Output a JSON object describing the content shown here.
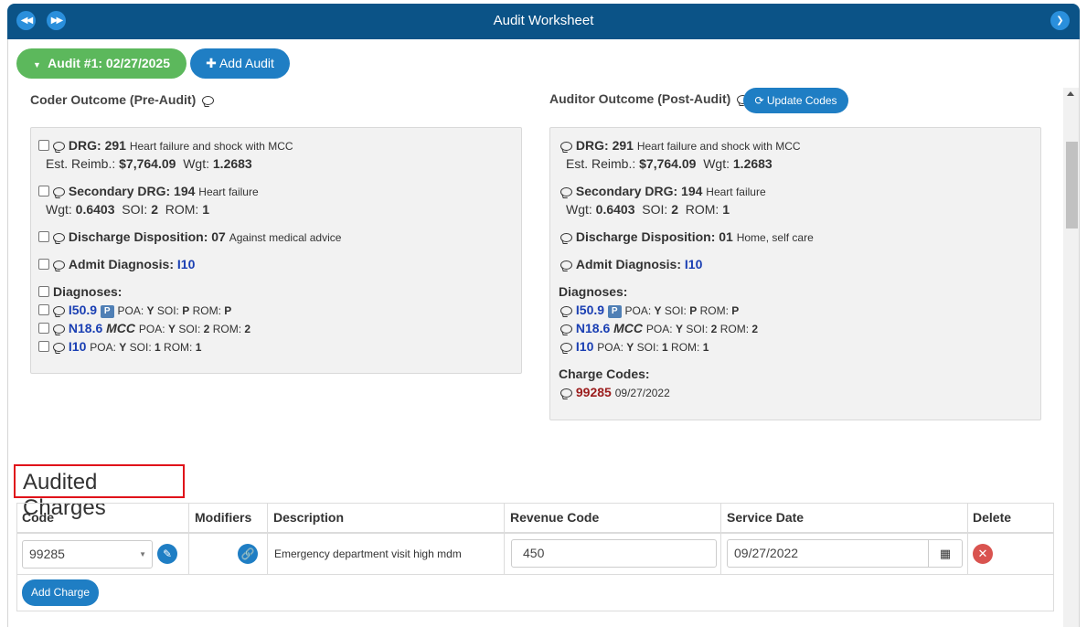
{
  "window": {
    "title": "Audit Worksheet"
  },
  "toolbar": {
    "audit_label": "Audit #1: 02/27/2025",
    "add_audit_label": "Add Audit"
  },
  "pre": {
    "heading": "Coder Outcome (Pre-Audit)",
    "drg_label": "DRG:",
    "drg_code": "291",
    "drg_desc": "Heart failure and shock with MCC",
    "reimb_label": "Est. Reimb.:",
    "reimb_value": "$7,764.09",
    "wgt_label": "Wgt:",
    "wgt_value": "1.2683",
    "sec_drg_label": "Secondary DRG:",
    "sec_drg_code": "194",
    "sec_drg_desc": "Heart failure",
    "sec_wgt_label": "Wgt:",
    "sec_wgt_value": "0.6403",
    "soi_label": "SOI:",
    "soi_value": "2",
    "rom_label": "ROM:",
    "rom_value": "1",
    "disp_label": "Discharge Disposition:",
    "disp_code": "07",
    "disp_desc": "Against medical advice",
    "admit_label": "Admit Diagnosis:",
    "admit_code": "I10",
    "diagnoses_label": "Diagnoses:",
    "diagnoses": [
      {
        "code": "I50.9",
        "badge": "P",
        "mcc": "",
        "poa": "Y",
        "soi": "P",
        "rom": "P"
      },
      {
        "code": "N18.6",
        "badge": "",
        "mcc": "MCC",
        "poa": "Y",
        "soi": "2",
        "rom": "2"
      },
      {
        "code": "I10",
        "badge": "",
        "mcc": "",
        "poa": "Y",
        "soi": "1",
        "rom": "1"
      }
    ]
  },
  "post": {
    "heading": "Auditor Outcome (Post-Audit)",
    "update_codes_label": "Update Codes",
    "drg_label": "DRG:",
    "drg_code": "291",
    "drg_desc": "Heart failure and shock with MCC",
    "reimb_label": "Est. Reimb.:",
    "reimb_value": "$7,764.09",
    "wgt_label": "Wgt:",
    "wgt_value": "1.2683",
    "sec_drg_label": "Secondary DRG:",
    "sec_drg_code": "194",
    "sec_drg_desc": "Heart failure",
    "sec_wgt_label": "Wgt:",
    "sec_wgt_value": "0.6403",
    "soi_label": "SOI:",
    "soi_value": "2",
    "rom_label": "ROM:",
    "rom_value": "1",
    "disp_label": "Discharge Disposition:",
    "disp_code": "01",
    "disp_desc": "Home, self care",
    "admit_label": "Admit Diagnosis:",
    "admit_code": "I10",
    "diagnoses_label": "Diagnoses:",
    "diagnoses": [
      {
        "code": "I50.9",
        "badge": "P",
        "mcc": "",
        "poa": "Y",
        "soi": "P",
        "rom": "P"
      },
      {
        "code": "N18.6",
        "badge": "",
        "mcc": "MCC",
        "poa": "Y",
        "soi": "2",
        "rom": "2"
      },
      {
        "code": "I10",
        "badge": "",
        "mcc": "",
        "poa": "Y",
        "soi": "1",
        "rom": "1"
      }
    ],
    "charge_codes_label": "Charge Codes:",
    "charge_code": "99285",
    "charge_date": "09/27/2022"
  },
  "charges": {
    "heading": "Audited Charges",
    "columns": [
      "Code",
      "Modifiers",
      "Description",
      "Revenue Code",
      "Service Date",
      "Delete"
    ],
    "rows": [
      {
        "code": "99285",
        "description": "Emergency department visit high mdm",
        "revenue_code": "450",
        "service_date": "09/27/2022"
      }
    ],
    "add_charge_label": "Add Charge"
  },
  "labels": {
    "poa": "POA:",
    "soi": "SOI:",
    "rom": "ROM:"
  },
  "colors": {
    "titlebar": "#0b5387",
    "primary": "#1f7ec4",
    "success": "#5cb85c",
    "danger": "#d9534f",
    "highlight": "#e0131a"
  },
  "icons": [
    "first-page-icon",
    "previous-page-icon",
    "next-icon",
    "caret-down-icon",
    "plus-icon",
    "comment-icon",
    "refresh-icon",
    "pencil-icon",
    "link-icon",
    "calendar-icon",
    "close-icon"
  ]
}
